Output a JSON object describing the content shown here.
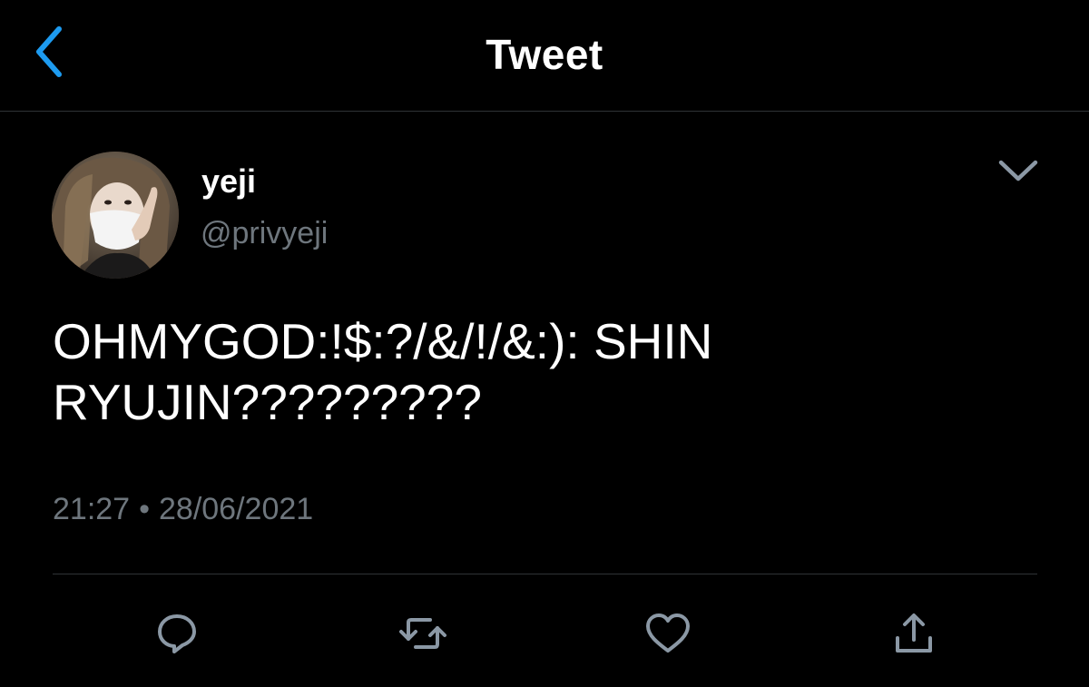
{
  "header": {
    "title": "Tweet",
    "back_icon": "chevron-left-icon"
  },
  "tweet": {
    "author": {
      "display_name": "yeji",
      "handle": "@privyeji"
    },
    "text": "OHMYGOD:!$:?/&/!/&:): SHIN\nRYUJIN?????????",
    "time": "21:27",
    "separator": "•",
    "date": "28/06/2021",
    "menu_icon": "chevron-down-icon"
  },
  "actions": [
    {
      "name": "reply",
      "icon": "reply-icon"
    },
    {
      "name": "retweet",
      "icon": "retweet-icon"
    },
    {
      "name": "like",
      "icon": "heart-icon"
    },
    {
      "name": "share",
      "icon": "share-icon"
    }
  ],
  "colors": {
    "background": "#000000",
    "accent": "#1d9bf0",
    "secondary_text": "#6e767d",
    "icon": "#8b98a5",
    "divider": "#2f3336"
  }
}
